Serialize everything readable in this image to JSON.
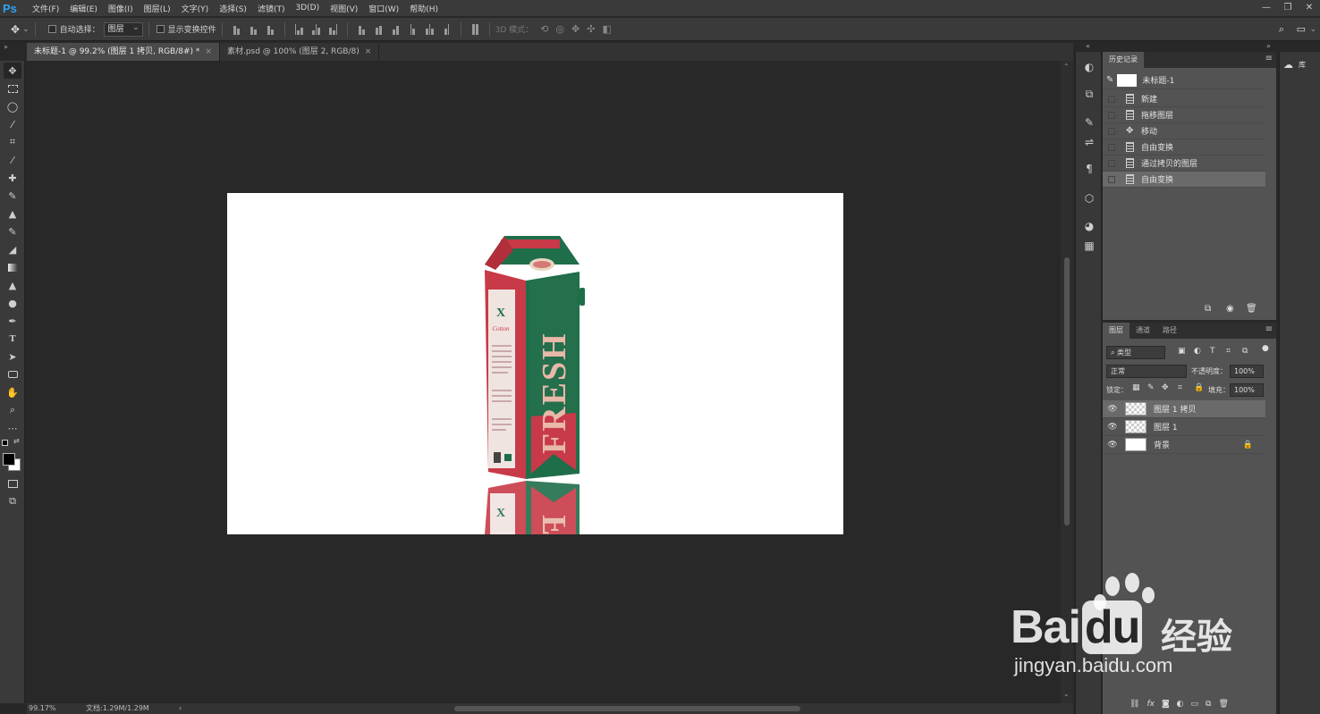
{
  "app": {
    "logo": "Ps"
  },
  "menubar": {
    "items": [
      "文件(F)",
      "编辑(E)",
      "图像(I)",
      "图层(L)",
      "文字(Y)",
      "选择(S)",
      "滤镜(T)",
      "3D(D)",
      "视图(V)",
      "窗口(W)",
      "帮助(H)"
    ]
  },
  "window_controls": {
    "minimize": "—",
    "restore": "❐",
    "close": "✕"
  },
  "options": {
    "auto_select_label": "自动选择：",
    "auto_select_value": "图层",
    "show_transform_label": "显示变换控件",
    "mode_3d_label": "3D 模式："
  },
  "tabs": [
    {
      "label": "未标题-1 @ 99.2% (图层 1 拷贝, RGB/8#) *",
      "close": "×"
    },
    {
      "label": "素材.psd @ 100% (图层 2, RGB/8)",
      "close": "×"
    }
  ],
  "history_panel": {
    "tab": "历史记录",
    "snapshot": "未标题-1",
    "items": [
      "新建",
      "拖移图层",
      "移动",
      "自由变换",
      "通过拷贝的图层",
      "自由变换"
    ],
    "selected_index": 5
  },
  "layers_panel": {
    "tabs": [
      "图层",
      "通道",
      "路径"
    ],
    "filter_kind": "类型",
    "blend_mode": "正常",
    "opacity_label": "不透明度：",
    "opacity": "100%",
    "lock_label": "锁定：",
    "fill_label": "填充：",
    "fill": "100%",
    "layers": [
      {
        "name": "图层 1 拷贝",
        "selected": true
      },
      {
        "name": "图层 1",
        "selected": false
      },
      {
        "name": "背景",
        "selected": false
      }
    ]
  },
  "library_panel": {
    "label": "库"
  },
  "product": {
    "brand_text": "FRESH",
    "reflection_text": "F"
  },
  "status": {
    "zoom": "99.17%",
    "doc": "文档:1.29M/1.29M"
  },
  "watermark": {
    "brand": "Bai",
    "brand2": "du",
    "cn": "经验",
    "url": "jingyan.baidu.com"
  },
  "colors": {
    "ps_blue": "#2fa3f5",
    "carton_green": "#1f6e4a",
    "carton_red": "#c83a48",
    "panel_bg": "#535353"
  }
}
